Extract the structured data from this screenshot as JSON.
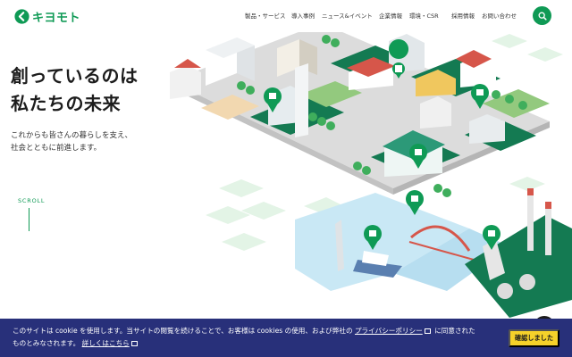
{
  "brand": {
    "name": "キヨモト",
    "accent": "#0f9a55"
  },
  "nav": {
    "items": [
      {
        "label": "製品・サービス"
      },
      {
        "label": "導入事例"
      },
      {
        "label": "ニュース&イベント"
      },
      {
        "label": "企業情報"
      },
      {
        "label": "環境・CSR"
      },
      {
        "label": "採用情報"
      },
      {
        "label": "お問い合わせ"
      }
    ],
    "search_icon": "search-icon"
  },
  "hero": {
    "title_line1": "創っているのは",
    "title_line2": "私たちの未来",
    "sub_line1": "これからも皆さんの暮らしを支え、",
    "sub_line2": "社会とともに前進します。",
    "scroll_label": "SCROLL"
  },
  "cookie": {
    "text_part1": "このサイトは cookie を使用します。当サイトの閲覧を続けることで、お客様は cookies の使用、および弊社の",
    "policy_link": "プライバシーポリシー",
    "text_part2": "に同意された",
    "text_part3": "ものとみなされます。",
    "details_link": "詳しくはこちら",
    "accept_label": "確認しました",
    "bg_color": "#28307a",
    "button_color": "#f5d12a"
  }
}
